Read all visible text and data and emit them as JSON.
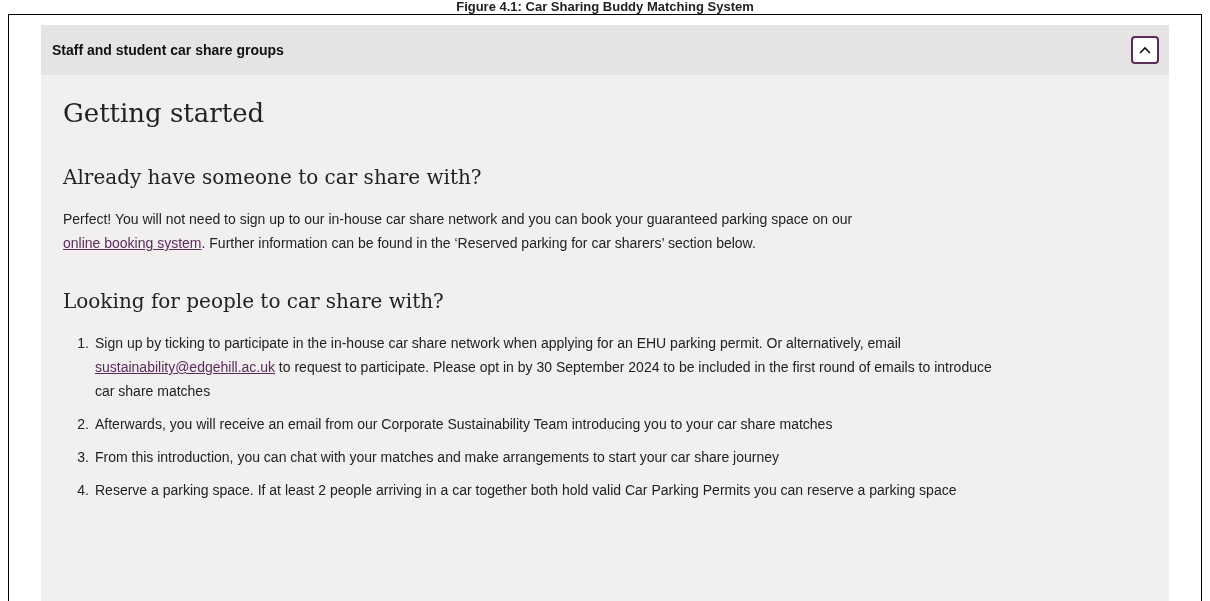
{
  "figure_caption": "Figure 4.1: Car Sharing Buddy Matching System",
  "accordion": {
    "title": "Staff and student car share groups",
    "expanded": true
  },
  "heading": "Getting started",
  "sections": [
    {
      "title": "Already have someone to car share with?",
      "paragraph": [
        {
          "kind": "text",
          "text": "Perfect! You will not need to sign up to our in-house car share network and you can book your guaranteed parking space on our "
        },
        {
          "kind": "link",
          "text": "online booking system"
        },
        {
          "kind": "text",
          "text": ". Further information can be found in the ‘Reserved parking for car sharers’ section below."
        }
      ]
    },
    {
      "title": "Looking for people to car share with?",
      "steps": [
        {
          "number": "1.",
          "parts": [
            {
              "kind": "text",
              "text": "Sign up by ticking to participate in the in-house car share network when applying for an EHU parking permit. Or alternatively, email "
            },
            {
              "kind": "link",
              "text": "sustainability@edgehill.ac.uk"
            },
            {
              "kind": "text",
              "text": " to request to participate. Please opt in by 30 September 2024 to be included in the first round of emails to introduce car share matches"
            }
          ]
        },
        {
          "number": "2.",
          "parts": [
            {
              "kind": "text",
              "text": "Afterwards, you will receive an email from our Corporate Sustainability Team introducing you to your car share matches"
            }
          ]
        },
        {
          "number": "3.",
          "parts": [
            {
              "kind": "text",
              "text": "From this introduction, you can chat with your matches and make arrangements to start your car share journey"
            }
          ]
        },
        {
          "number": "4.",
          "parts": [
            {
              "kind": "text",
              "text": "Reserve a parking space. If at least 2 people arriving in a car together both hold valid Car Parking Permits you can reserve a parking space"
            }
          ]
        }
      ]
    }
  ]
}
